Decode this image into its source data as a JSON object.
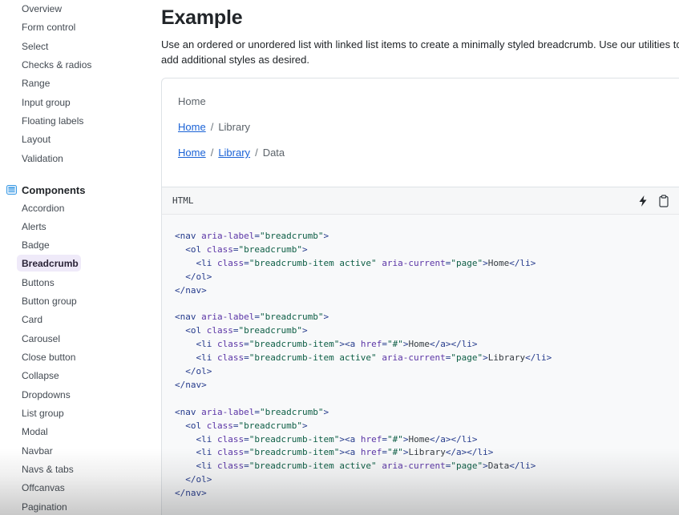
{
  "sidebar": {
    "forms_items": [
      "Overview",
      "Form control",
      "Select",
      "Checks & radios",
      "Range",
      "Input group",
      "Floating labels",
      "Layout",
      "Validation"
    ],
    "components_heading": "Components",
    "components_items": [
      "Accordion",
      "Alerts",
      "Badge",
      "Breadcrumb",
      "Buttons",
      "Button group",
      "Card",
      "Carousel",
      "Close button",
      "Collapse",
      "Dropdowns",
      "List group",
      "Modal",
      "Navbar",
      "Navs & tabs",
      "Offcanvas",
      "Pagination"
    ],
    "active_item": "Breadcrumb"
  },
  "main": {
    "title": "Example",
    "lead": "Use an ordered or unordered list with linked list items to create a minimally styled breadcrumb. Use our utilities to add additional styles as desired.",
    "example": {
      "separator": "/",
      "crumbs": [
        {
          "links": [],
          "current": "Home"
        },
        {
          "links": [
            "Home"
          ],
          "current": "Library"
        },
        {
          "links": [
            "Home",
            "Library"
          ],
          "current": "Data"
        }
      ]
    },
    "code": {
      "language": "HTML",
      "lines": [
        [
          [
            "tag",
            "<nav "
          ],
          [
            "attr",
            "aria-label"
          ],
          [
            "tag",
            "="
          ],
          [
            "str",
            "\"breadcrumb\""
          ],
          [
            "tag",
            ">"
          ]
        ],
        [
          [
            "tag",
            "  <ol "
          ],
          [
            "attr",
            "class"
          ],
          [
            "tag",
            "="
          ],
          [
            "str",
            "\"breadcrumb\""
          ],
          [
            "tag",
            ">"
          ]
        ],
        [
          [
            "tag",
            "    <li "
          ],
          [
            "attr",
            "class"
          ],
          [
            "tag",
            "="
          ],
          [
            "str",
            "\"breadcrumb-item active\""
          ],
          [
            "tag",
            " "
          ],
          [
            "attr",
            "aria-current"
          ],
          [
            "tag",
            "="
          ],
          [
            "str",
            "\"page\""
          ],
          [
            "tag",
            ">"
          ],
          [
            "text",
            "Home"
          ],
          [
            "tag",
            "</li>"
          ]
        ],
        [
          [
            "tag",
            "  </ol>"
          ]
        ],
        [
          [
            "tag",
            "</nav>"
          ]
        ],
        [],
        [
          [
            "tag",
            "<nav "
          ],
          [
            "attr",
            "aria-label"
          ],
          [
            "tag",
            "="
          ],
          [
            "str",
            "\"breadcrumb\""
          ],
          [
            "tag",
            ">"
          ]
        ],
        [
          [
            "tag",
            "  <ol "
          ],
          [
            "attr",
            "class"
          ],
          [
            "tag",
            "="
          ],
          [
            "str",
            "\"breadcrumb\""
          ],
          [
            "tag",
            ">"
          ]
        ],
        [
          [
            "tag",
            "    <li "
          ],
          [
            "attr",
            "class"
          ],
          [
            "tag",
            "="
          ],
          [
            "str",
            "\"breadcrumb-item\""
          ],
          [
            "tag",
            "><a "
          ],
          [
            "attr",
            "href"
          ],
          [
            "tag",
            "="
          ],
          [
            "str",
            "\"#\""
          ],
          [
            "tag",
            ">"
          ],
          [
            "text",
            "Home"
          ],
          [
            "tag",
            "</a></li>"
          ]
        ],
        [
          [
            "tag",
            "    <li "
          ],
          [
            "attr",
            "class"
          ],
          [
            "tag",
            "="
          ],
          [
            "str",
            "\"breadcrumb-item active\""
          ],
          [
            "tag",
            " "
          ],
          [
            "attr",
            "aria-current"
          ],
          [
            "tag",
            "="
          ],
          [
            "str",
            "\"page\""
          ],
          [
            "tag",
            ">"
          ],
          [
            "text",
            "Library"
          ],
          [
            "tag",
            "</li>"
          ]
        ],
        [
          [
            "tag",
            "  </ol>"
          ]
        ],
        [
          [
            "tag",
            "</nav>"
          ]
        ],
        [],
        [
          [
            "tag",
            "<nav "
          ],
          [
            "attr",
            "aria-label"
          ],
          [
            "tag",
            "="
          ],
          [
            "str",
            "\"breadcrumb\""
          ],
          [
            "tag",
            ">"
          ]
        ],
        [
          [
            "tag",
            "  <ol "
          ],
          [
            "attr",
            "class"
          ],
          [
            "tag",
            "="
          ],
          [
            "str",
            "\"breadcrumb\""
          ],
          [
            "tag",
            ">"
          ]
        ],
        [
          [
            "tag",
            "    <li "
          ],
          [
            "attr",
            "class"
          ],
          [
            "tag",
            "="
          ],
          [
            "str",
            "\"breadcrumb-item\""
          ],
          [
            "tag",
            "><a "
          ],
          [
            "attr",
            "href"
          ],
          [
            "tag",
            "="
          ],
          [
            "str",
            "\"#\""
          ],
          [
            "tag",
            ">"
          ],
          [
            "text",
            "Home"
          ],
          [
            "tag",
            "</a></li>"
          ]
        ],
        [
          [
            "tag",
            "    <li "
          ],
          [
            "attr",
            "class"
          ],
          [
            "tag",
            "="
          ],
          [
            "str",
            "\"breadcrumb-item\""
          ],
          [
            "tag",
            "><a "
          ],
          [
            "attr",
            "href"
          ],
          [
            "tag",
            "="
          ],
          [
            "str",
            "\"#\""
          ],
          [
            "tag",
            ">"
          ],
          [
            "text",
            "Library"
          ],
          [
            "tag",
            "</a></li>"
          ]
        ],
        [
          [
            "tag",
            "    <li "
          ],
          [
            "attr",
            "class"
          ],
          [
            "tag",
            "="
          ],
          [
            "str",
            "\"breadcrumb-item active\""
          ],
          [
            "tag",
            " "
          ],
          [
            "attr",
            "aria-current"
          ],
          [
            "tag",
            "="
          ],
          [
            "str",
            "\"page\""
          ],
          [
            "tag",
            ">"
          ],
          [
            "text",
            "Data"
          ],
          [
            "tag",
            "</li>"
          ]
        ],
        [
          [
            "tag",
            "  </ol>"
          ]
        ],
        [
          [
            "tag",
            "</nav>"
          ]
        ]
      ]
    }
  },
  "colors": {
    "accent_active_bg": "#efeaf9",
    "link": "#1a62d6",
    "code_tag": "#253b8c",
    "code_attr": "#5b35a6",
    "code_string": "#0d5e45"
  },
  "icons": {
    "components": "components-icon",
    "bolt": "bolt-icon",
    "clipboard": "clipboard-icon"
  }
}
